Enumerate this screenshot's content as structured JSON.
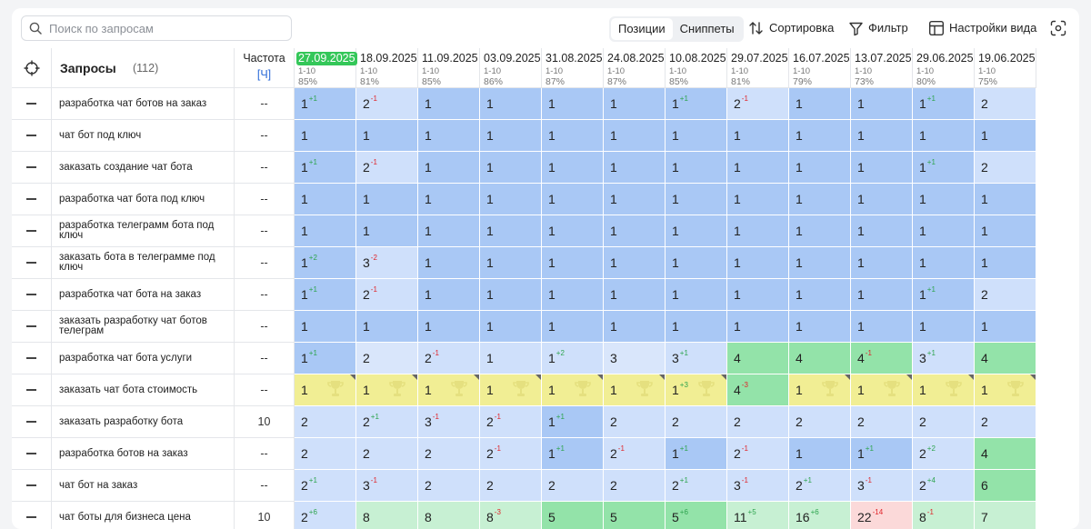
{
  "toolbar": {
    "search_placeholder": "Поиск по запросам",
    "seg_positions": "Позиции",
    "seg_snippets": "Сниппеты",
    "sort": "Сортировка",
    "filter": "Фильтр",
    "view_settings": "Настройки вида"
  },
  "table": {
    "queries_title": "Запросы",
    "queries_count": "(112)",
    "freq_title": "Частота",
    "freq_unit": "[Ч]",
    "dates": [
      {
        "date": "27.09.2025",
        "range": "1-10",
        "pct": "85%",
        "current": true
      },
      {
        "date": "18.09.2025",
        "range": "1-10",
        "pct": "81%"
      },
      {
        "date": "11.09.2025",
        "range": "1-10",
        "pct": "85%"
      },
      {
        "date": "03.09.2025",
        "range": "1-10",
        "pct": "86%"
      },
      {
        "date": "31.08.2025",
        "range": "1-10",
        "pct": "87%"
      },
      {
        "date": "24.08.2025",
        "range": "1-10",
        "pct": "87%"
      },
      {
        "date": "10.08.2025",
        "range": "1-10",
        "pct": "85%"
      },
      {
        "date": "29.07.2025",
        "range": "1-10",
        "pct": "81%"
      },
      {
        "date": "16.07.2025",
        "range": "1-10",
        "pct": "79%"
      },
      {
        "date": "13.07.2025",
        "range": "1-10",
        "pct": "73%"
      },
      {
        "date": "29.06.2025",
        "range": "1-10",
        "pct": "80%"
      },
      {
        "date": "19.06.2025",
        "range": "1-10",
        "pct": "75%"
      }
    ],
    "rows": [
      {
        "query": "разработка чат ботов на заказ",
        "freq": "--",
        "cells": [
          {
            "v": "1",
            "d": "+1",
            "c": "p1"
          },
          {
            "v": "2",
            "d": "-1",
            "c": "p2"
          },
          {
            "v": "1",
            "c": "p1"
          },
          {
            "v": "1",
            "c": "p1"
          },
          {
            "v": "1",
            "c": "p1"
          },
          {
            "v": "1",
            "c": "p1"
          },
          {
            "v": "1",
            "d": "+1",
            "c": "p1"
          },
          {
            "v": "2",
            "d": "-1",
            "c": "p2"
          },
          {
            "v": "1",
            "c": "p1"
          },
          {
            "v": "1",
            "c": "p1"
          },
          {
            "v": "1",
            "d": "+1",
            "c": "p1"
          },
          {
            "v": "2",
            "c": "p2"
          }
        ]
      },
      {
        "query": "чат бот под ключ",
        "freq": "--",
        "cells": [
          {
            "v": "1",
            "c": "p1"
          },
          {
            "v": "1",
            "c": "p1"
          },
          {
            "v": "1",
            "c": "p1"
          },
          {
            "v": "1",
            "c": "p1"
          },
          {
            "v": "1",
            "c": "p1"
          },
          {
            "v": "1",
            "c": "p1"
          },
          {
            "v": "1",
            "c": "p1"
          },
          {
            "v": "1",
            "c": "p1"
          },
          {
            "v": "1",
            "c": "p1"
          },
          {
            "v": "1",
            "c": "p1"
          },
          {
            "v": "1",
            "c": "p1"
          },
          {
            "v": "1",
            "c": "p1"
          }
        ]
      },
      {
        "query": "заказать создание чат бота",
        "freq": "--",
        "cells": [
          {
            "v": "1",
            "d": "+1",
            "c": "p1"
          },
          {
            "v": "2",
            "d": "-1",
            "c": "p2"
          },
          {
            "v": "1",
            "c": "p1"
          },
          {
            "v": "1",
            "c": "p1"
          },
          {
            "v": "1",
            "c": "p1"
          },
          {
            "v": "1",
            "c": "p1"
          },
          {
            "v": "1",
            "c": "p1"
          },
          {
            "v": "1",
            "c": "p1"
          },
          {
            "v": "1",
            "c": "p1"
          },
          {
            "v": "1",
            "c": "p1"
          },
          {
            "v": "1",
            "d": "+1",
            "c": "p1"
          },
          {
            "v": "2",
            "c": "p2"
          }
        ]
      },
      {
        "query": "разработка чат бота под ключ",
        "freq": "--",
        "cells": [
          {
            "v": "1",
            "c": "p1"
          },
          {
            "v": "1",
            "c": "p1"
          },
          {
            "v": "1",
            "c": "p1"
          },
          {
            "v": "1",
            "c": "p1"
          },
          {
            "v": "1",
            "c": "p1"
          },
          {
            "v": "1",
            "c": "p1"
          },
          {
            "v": "1",
            "c": "p1"
          },
          {
            "v": "1",
            "c": "p1"
          },
          {
            "v": "1",
            "c": "p1"
          },
          {
            "v": "1",
            "c": "p1"
          },
          {
            "v": "1",
            "c": "p1"
          },
          {
            "v": "1",
            "c": "p1"
          }
        ]
      },
      {
        "query": "разработка телеграмм бота под ключ",
        "freq": "--",
        "cells": [
          {
            "v": "1",
            "c": "p1"
          },
          {
            "v": "1",
            "c": "p1"
          },
          {
            "v": "1",
            "c": "p1"
          },
          {
            "v": "1",
            "c": "p1"
          },
          {
            "v": "1",
            "c": "p1"
          },
          {
            "v": "1",
            "c": "p1"
          },
          {
            "v": "1",
            "c": "p1"
          },
          {
            "v": "1",
            "c": "p1"
          },
          {
            "v": "1",
            "c": "p1"
          },
          {
            "v": "1",
            "c": "p1"
          },
          {
            "v": "1",
            "c": "p1"
          },
          {
            "v": "1",
            "c": "p1"
          }
        ]
      },
      {
        "query": "заказать бота в телеграмме под ключ",
        "freq": "--",
        "cells": [
          {
            "v": "1",
            "d": "+2",
            "c": "p1"
          },
          {
            "v": "3",
            "d": "-2",
            "c": "p2"
          },
          {
            "v": "1",
            "c": "p1"
          },
          {
            "v": "1",
            "c": "p1"
          },
          {
            "v": "1",
            "c": "p1"
          },
          {
            "v": "1",
            "c": "p1"
          },
          {
            "v": "1",
            "c": "p1"
          },
          {
            "v": "1",
            "c": "p1"
          },
          {
            "v": "1",
            "c": "p1"
          },
          {
            "v": "1",
            "c": "p1"
          },
          {
            "v": "1",
            "c": "p1"
          },
          {
            "v": "1",
            "c": "p1"
          }
        ]
      },
      {
        "query": "разработка чат бота на заказ",
        "freq": "--",
        "cells": [
          {
            "v": "1",
            "d": "+1",
            "c": "p1"
          },
          {
            "v": "2",
            "d": "-1",
            "c": "p2"
          },
          {
            "v": "1",
            "c": "p1"
          },
          {
            "v": "1",
            "c": "p1"
          },
          {
            "v": "1",
            "c": "p1"
          },
          {
            "v": "1",
            "c": "p1"
          },
          {
            "v": "1",
            "c": "p1"
          },
          {
            "v": "1",
            "c": "p1"
          },
          {
            "v": "1",
            "c": "p1"
          },
          {
            "v": "1",
            "c": "p1"
          },
          {
            "v": "1",
            "d": "+1",
            "c": "p1"
          },
          {
            "v": "2",
            "c": "p2"
          }
        ]
      },
      {
        "query": "заказать разработку чат ботов телеграм",
        "freq": "--",
        "cells": [
          {
            "v": "1",
            "c": "p1"
          },
          {
            "v": "1",
            "c": "p1"
          },
          {
            "v": "1",
            "c": "p1"
          },
          {
            "v": "1",
            "c": "p1"
          },
          {
            "v": "1",
            "c": "p1"
          },
          {
            "v": "1",
            "c": "p1"
          },
          {
            "v": "1",
            "c": "p1"
          },
          {
            "v": "1",
            "c": "p1"
          },
          {
            "v": "1",
            "c": "p1"
          },
          {
            "v": "1",
            "c": "p1"
          },
          {
            "v": "1",
            "c": "p1"
          },
          {
            "v": "1",
            "c": "p1"
          }
        ]
      },
      {
        "query": "разработка чат бота услуги",
        "freq": "--",
        "cells": [
          {
            "v": "1",
            "d": "+1",
            "c": "p1"
          },
          {
            "v": "2",
            "c": "p3"
          },
          {
            "v": "2",
            "d": "-1",
            "c": "p2"
          },
          {
            "v": "1",
            "c": "p2"
          },
          {
            "v": "1",
            "d": "+2",
            "c": "p2"
          },
          {
            "v": "3",
            "c": "p3"
          },
          {
            "v": "3",
            "d": "+1",
            "c": "p2"
          },
          {
            "v": "4",
            "c": "pg"
          },
          {
            "v": "4",
            "c": "pg"
          },
          {
            "v": "4",
            "d": "-1",
            "c": "pg"
          },
          {
            "v": "3",
            "d": "+1",
            "c": "p2"
          },
          {
            "v": "4",
            "c": "pg"
          }
        ]
      },
      {
        "query": "заказать чат бота стоимость",
        "freq": "--",
        "cells": [
          {
            "v": "1",
            "c": "py",
            "t": true
          },
          {
            "v": "1",
            "c": "py",
            "t": true
          },
          {
            "v": "1",
            "c": "py",
            "t": true
          },
          {
            "v": "1",
            "c": "py",
            "t": true
          },
          {
            "v": "1",
            "c": "py",
            "t": true
          },
          {
            "v": "1",
            "c": "py",
            "t": true
          },
          {
            "v": "1",
            "d": "+3",
            "c": "py",
            "t": true
          },
          {
            "v": "4",
            "d": "-3",
            "c": "pg"
          },
          {
            "v": "1",
            "c": "py",
            "t": true
          },
          {
            "v": "1",
            "c": "py",
            "t": true
          },
          {
            "v": "1",
            "c": "py",
            "t": true
          },
          {
            "v": "1",
            "c": "py",
            "t": true
          }
        ]
      },
      {
        "query": "заказать разработку бота",
        "freq": "10",
        "cells": [
          {
            "v": "2",
            "c": "p2"
          },
          {
            "v": "2",
            "d": "+1",
            "c": "p2"
          },
          {
            "v": "3",
            "d": "-1",
            "c": "p2"
          },
          {
            "v": "2",
            "d": "-1",
            "c": "p2"
          },
          {
            "v": "1",
            "d": "+1",
            "c": "p1"
          },
          {
            "v": "2",
            "c": "p2"
          },
          {
            "v": "2",
            "c": "p2"
          },
          {
            "v": "2",
            "c": "p2"
          },
          {
            "v": "2",
            "c": "p2"
          },
          {
            "v": "2",
            "c": "p2"
          },
          {
            "v": "2",
            "c": "p2"
          },
          {
            "v": "2",
            "c": "p2"
          }
        ]
      },
      {
        "query": "разработка ботов на заказ",
        "freq": "--",
        "cells": [
          {
            "v": "2",
            "c": "p2"
          },
          {
            "v": "2",
            "c": "p2"
          },
          {
            "v": "2",
            "c": "p2"
          },
          {
            "v": "2",
            "d": "-1",
            "c": "p2"
          },
          {
            "v": "1",
            "d": "+1",
            "c": "p1"
          },
          {
            "v": "2",
            "d": "-1",
            "c": "p2"
          },
          {
            "v": "1",
            "d": "+1",
            "c": "p1"
          },
          {
            "v": "2",
            "d": "-1",
            "c": "p2"
          },
          {
            "v": "1",
            "c": "p1"
          },
          {
            "v": "1",
            "d": "+1",
            "c": "p1"
          },
          {
            "v": "2",
            "d": "+2",
            "c": "p2"
          },
          {
            "v": "4",
            "c": "pg"
          }
        ]
      },
      {
        "query": "чат бот на заказ",
        "freq": "--",
        "cells": [
          {
            "v": "2",
            "d": "+1",
            "c": "p2"
          },
          {
            "v": "3",
            "d": "-1",
            "c": "p2"
          },
          {
            "v": "2",
            "c": "p2"
          },
          {
            "v": "2",
            "c": "p2"
          },
          {
            "v": "2",
            "c": "p2"
          },
          {
            "v": "2",
            "c": "p2"
          },
          {
            "v": "2",
            "d": "+1",
            "c": "p2"
          },
          {
            "v": "3",
            "d": "-1",
            "c": "p2"
          },
          {
            "v": "2",
            "d": "+1",
            "c": "p2"
          },
          {
            "v": "3",
            "d": "-1",
            "c": "p2"
          },
          {
            "v": "2",
            "d": "+4",
            "c": "p2"
          },
          {
            "v": "6",
            "c": "pg"
          }
        ]
      },
      {
        "query": "чат боты для бизнеса цена",
        "freq": "10",
        "cells": [
          {
            "v": "2",
            "d": "+6",
            "c": "p2"
          },
          {
            "v": "8",
            "c": "plg"
          },
          {
            "v": "8",
            "c": "plg"
          },
          {
            "v": "8",
            "d": "-3",
            "c": "plg"
          },
          {
            "v": "5",
            "c": "pg"
          },
          {
            "v": "5",
            "c": "pg"
          },
          {
            "v": "5",
            "d": "+6",
            "c": "pg"
          },
          {
            "v": "11",
            "d": "+5",
            "c": "plg"
          },
          {
            "v": "16",
            "d": "+6",
            "c": "plg"
          },
          {
            "v": "22",
            "d": "-14",
            "c": "pr"
          },
          {
            "v": "8",
            "d": "-1",
            "c": "plg"
          },
          {
            "v": "7",
            "c": "plg"
          }
        ]
      }
    ]
  }
}
